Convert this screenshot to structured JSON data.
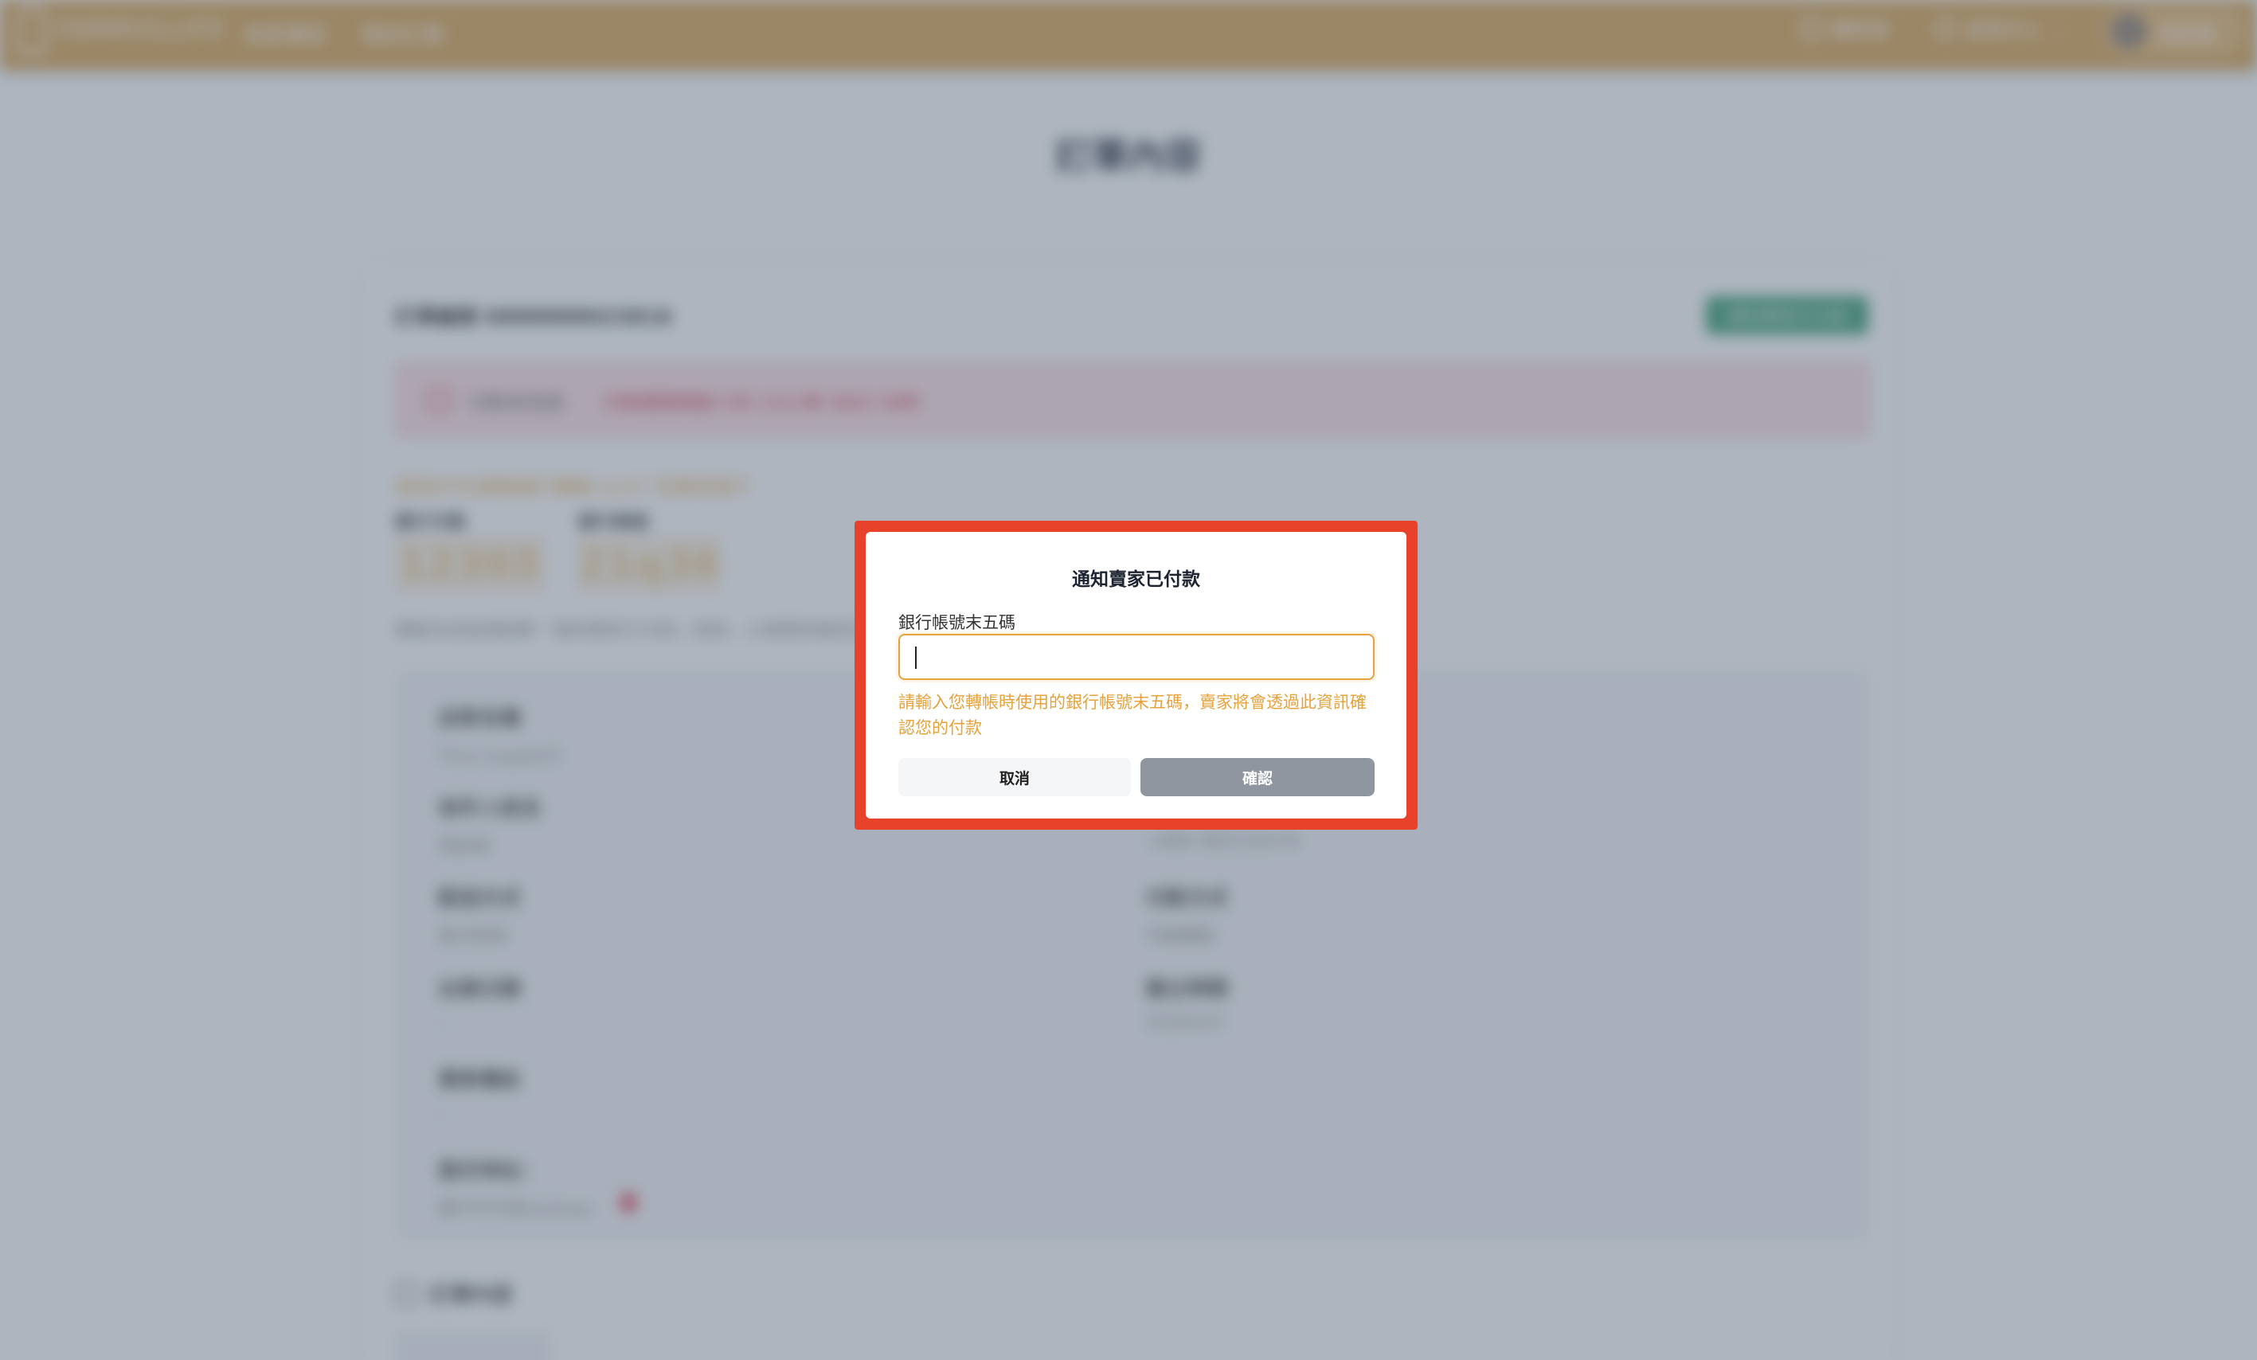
{
  "background_page": {
    "logo_text": "FARMVILLIFE",
    "nav": [
      "商家專區",
      "我的訂單"
    ],
    "top_right": [
      "購物車",
      "會員中心"
    ],
    "user_name": "測試者",
    "page_title": "訂單內容",
    "order_number": "訂單編號 0000000023816",
    "notify_button": "通知賣家已付款",
    "alert_label": "付款未完成",
    "alert_text": "付款期限剩餘 0天 23小時 58分 59秒",
    "bank_hint": "請用ATM/網路銀行轉帳 $147 至賣家帳戶",
    "bank_code_label": "銀行代碼",
    "bank_account_label": "銀行帳號",
    "bank_code": "12365",
    "bank_account": "21q36",
    "bank_note": "轉帳完成後請點擊「通知賣家已付款」按鈕，以便賣家確認您的付款",
    "info": [
      {
        "label": "店家名稱",
        "value": "Tims Supply行"
      },
      {
        "label": "收件人姓名",
        "value": "測試者"
      },
      {
        "label": "配送方式",
        "value": "面交取貨"
      },
      {
        "label": "付款方式",
        "value": "手動轉帳"
      },
      {
        "label": "出貨日期",
        "value": "-"
      },
      {
        "label": "建立時間",
        "value": "2026/4/3"
      },
      {
        "label": "買家備註",
        "value": "-"
      },
      {
        "label": "面交地址：",
        "value": "臺中市中區textaaa"
      }
    ],
    "phone_value": "+886 985535078",
    "section_title": "訂單內容"
  },
  "modal": {
    "title": "通知賣家已付款",
    "field_label": "銀行帳號末五碼",
    "input_value": "",
    "input_placeholder": "",
    "help_text": "請輸入您轉帳時使用的銀行帳號末五碼，賣家將會透過此資訊確認您的付款",
    "cancel_label": "取消",
    "confirm_label": "確認"
  },
  "colors": {
    "topbar": "#d9a24c",
    "accent": "#e6a23c",
    "highlight_frame": "#e8432a",
    "confirm_button": "#8f969f",
    "overlay": "#5e6c80"
  }
}
